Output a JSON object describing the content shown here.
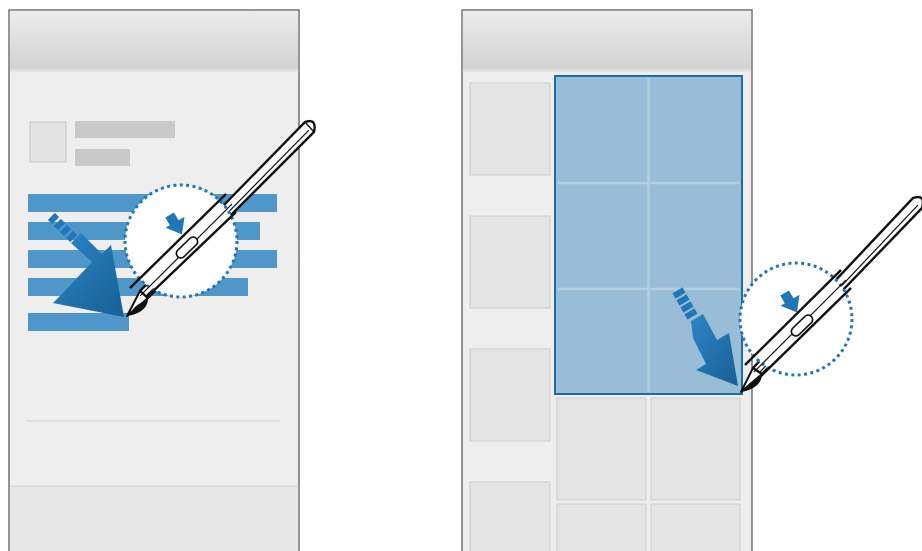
{
  "figure": {
    "panels": [
      {
        "id": "left",
        "type": "text-selection",
        "selection_lines": 5
      },
      {
        "id": "right",
        "type": "grid-selection",
        "grid_rows": 5,
        "grid_cols": 2,
        "selected_rows": 3,
        "selected_cols": 2
      }
    ],
    "colors": {
      "phone_outline": "#555555",
      "header_gradient_top": "#ececec",
      "header_gradient_bottom": "#d4d4d4",
      "body_background": "#eeeeee",
      "placeholder_block": "#c9c9c9",
      "tile_fill": "#e4e4e4",
      "tile_border": "#cfcfcf",
      "selection_fill": "#99bdd6",
      "selection_border": "#1a6ea5",
      "text_highlight": "#4f97c9",
      "arrow_blue": "#1f77b8",
      "pen_stroke": "#111111",
      "magnifier_dots": "#1f77b8"
    },
    "icons": [
      "s-pen-icon",
      "drag-arrow-icon",
      "pen-button-magnifier-icon"
    ]
  }
}
